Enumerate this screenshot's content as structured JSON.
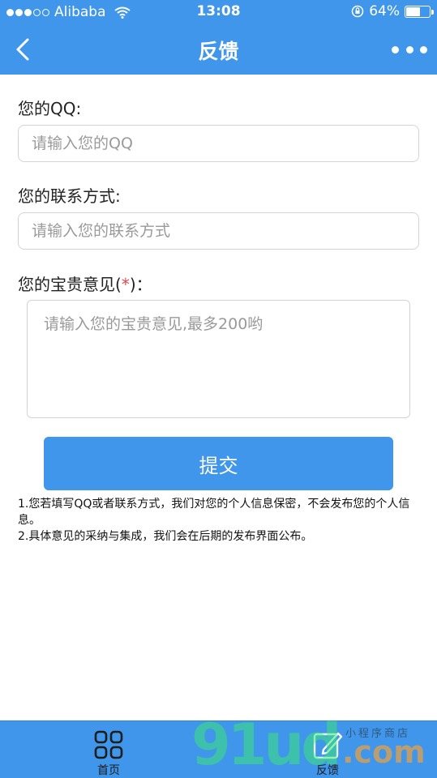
{
  "status_bar": {
    "carrier": "Alibaba",
    "time": "13:08",
    "battery": "64%",
    "battery_level": 0.64,
    "signal_strength": 3,
    "signal_max": 5
  },
  "nav": {
    "title": "反馈",
    "back_icon": "chevron-left-icon",
    "more_icon": "more-dots-icon"
  },
  "form": {
    "qq_label": "您的QQ:",
    "qq_placeholder": "请输入您的QQ",
    "contact_label": "您的联系方式:",
    "contact_placeholder": "请输入您的联系方式",
    "feedback_label_prefix": "您的宝贵意见(",
    "feedback_label_required": "*",
    "feedback_label_suffix": ")：",
    "feedback_placeholder": "请输入您的宝贵意见,最多200哟",
    "submit_label": "提交"
  },
  "notes": [
    "1.您若填写QQ或者联系方式，我们对您的个人信息保密，不会发布您的个人信息。",
    "2.具体意见的采纳与集成，我们会在后期的发布界面公布。"
  ],
  "tab_bar": {
    "tabs": [
      {
        "label": "首页",
        "icon": "grid-icon"
      },
      {
        "label": "反馈",
        "icon": "pencil-icon"
      }
    ]
  },
  "watermark": {
    "text": "91ud",
    "suffix": ".com",
    "cn": "小程序商店"
  },
  "colors": {
    "primary": "#3f96ea",
    "required": "#e0474c"
  }
}
